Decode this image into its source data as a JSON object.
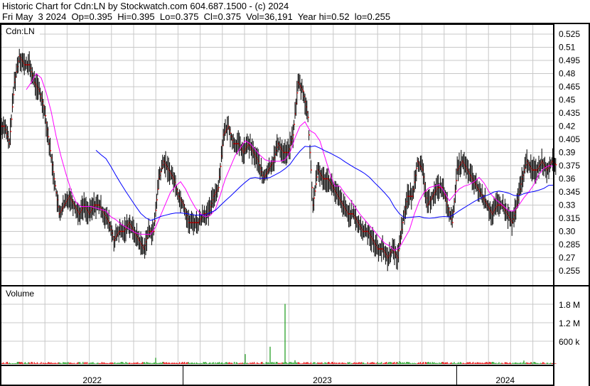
{
  "header": {
    "title": "Historic Chart for Cdn:LN by Stockwatch.com 604.687.1500 - (c) 2024",
    "quote": "Fri May  3 2024  Op=0.395  Hi=0.395  Lo=0.375  Cl=0.375  Vol=36,191  Year hi=0.52  lo=0.255"
  },
  "chart_data": {
    "type": "line",
    "title": "Cdn:LN",
    "volume_label": "Volume",
    "price_ticks": [
      "0.525",
      "0.51",
      "0.495",
      "0.48",
      "0.465",
      "0.45",
      "0.435",
      "0.42",
      "0.405",
      "0.39",
      "0.375",
      "0.36",
      "0.345",
      "0.33",
      "0.315",
      "0.30",
      "0.285",
      "0.27",
      "0.255"
    ],
    "ylim": [
      0.2475,
      0.5325
    ],
    "volume_ticks": [
      {
        "label": "1.8 M",
        "value": 1800000
      },
      {
        "label": "1.2 M",
        "value": 1200000
      },
      {
        "label": "600 k",
        "value": 600000
      }
    ],
    "volume_max": 2050000,
    "years": [
      {
        "label": "2022",
        "from": 0,
        "to": 36
      },
      {
        "label": "2023",
        "from": 37,
        "to": 92
      },
      {
        "label": "2024",
        "from": 92,
        "to": 111
      }
    ],
    "ma_windows": {
      "short": 6,
      "long": 20
    },
    "colors": {
      "up": "#2aa02a",
      "down": "#e01010",
      "short_ma": "#ff00ff",
      "long_ma": "#0000ff",
      "close_tick": "#ff0000",
      "grid": "#c8c8c8"
    },
    "closes": [
      0.42,
      0.4,
      0.47,
      0.5,
      0.49,
      0.49,
      0.47,
      0.46,
      0.44,
      0.4,
      0.36,
      0.32,
      0.33,
      0.34,
      0.33,
      0.32,
      0.33,
      0.32,
      0.33,
      0.33,
      0.32,
      0.31,
      0.29,
      0.3,
      0.3,
      0.31,
      0.3,
      0.29,
      0.28,
      0.3,
      0.3,
      0.36,
      0.38,
      0.37,
      0.36,
      0.34,
      0.33,
      0.31,
      0.31,
      0.31,
      0.32,
      0.32,
      0.34,
      0.35,
      0.41,
      0.42,
      0.4,
      0.4,
      0.39,
      0.4,
      0.39,
      0.38,
      0.36,
      0.37,
      0.38,
      0.4,
      0.39,
      0.39,
      0.41,
      0.47,
      0.46,
      0.43,
      0.33,
      0.37,
      0.36,
      0.36,
      0.35,
      0.34,
      0.33,
      0.32,
      0.32,
      0.31,
      0.3,
      0.3,
      0.29,
      0.28,
      0.28,
      0.27,
      0.28,
      0.27,
      0.31,
      0.34,
      0.34,
      0.38,
      0.37,
      0.33,
      0.34,
      0.35,
      0.35,
      0.33,
      0.31,
      0.37,
      0.38,
      0.37,
      0.36,
      0.35,
      0.34,
      0.33,
      0.32,
      0.33,
      0.33,
      0.32,
      0.31,
      0.33,
      0.36,
      0.38,
      0.37,
      0.37,
      0.38,
      0.37,
      0.38,
      0.375
    ],
    "volumes": {
      "default": 40000,
      "spikes": {
        "31": 200000,
        "49": 320000,
        "54": 560000,
        "57": 1950000,
        "59": 120000,
        "80": 90000,
        "105": 110000,
        "111": 80000
      }
    }
  }
}
